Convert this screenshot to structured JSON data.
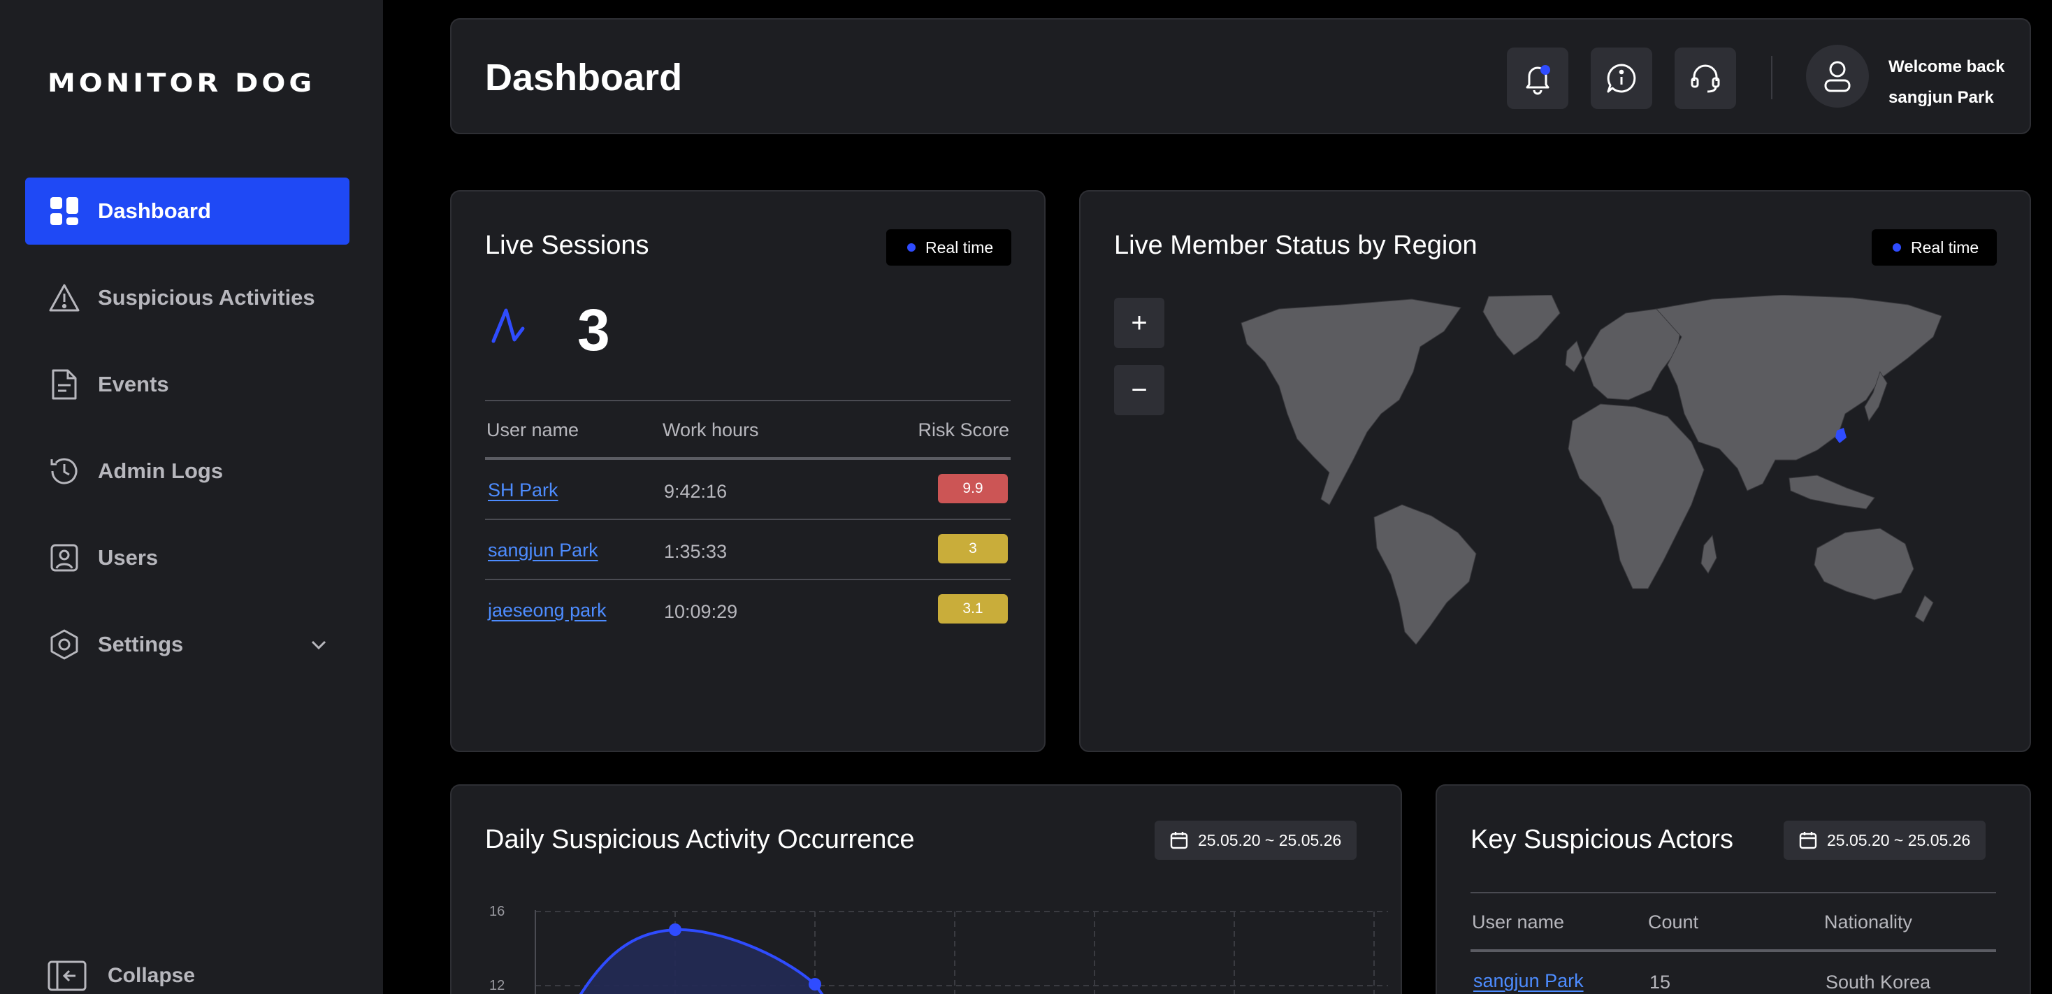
{
  "sidebar": {
    "logo": "MONITOR DOG",
    "items": [
      {
        "label": "Dashboard",
        "icon": "dashboard-icon",
        "active": true
      },
      {
        "label": "Suspicious Activities",
        "icon": "warning-icon"
      },
      {
        "label": "Events",
        "icon": "document-icon"
      },
      {
        "label": "Admin Logs",
        "icon": "history-icon"
      },
      {
        "label": "Users",
        "icon": "user-card-icon"
      },
      {
        "label": "Settings",
        "icon": "hexagon-settings-icon"
      }
    ],
    "collapse_label": "Collapse"
  },
  "header": {
    "title": "Dashboard",
    "welcome": "Welcome back",
    "user_name": "sangjun Park"
  },
  "live_sessions": {
    "title": "Live Sessions",
    "badge": "Real time",
    "count": "3",
    "columns": [
      "User name",
      "Work hours",
      "Risk Score"
    ],
    "rows": [
      {
        "user": "SH Park",
        "hours": "9:42:16",
        "score": "9.9",
        "color": "#cc5555"
      },
      {
        "user": "sangjun Park",
        "hours": "1:35:33",
        "score": "3",
        "color": "#c9ad3a"
      },
      {
        "user": "jaeseong park",
        "hours": "10:09:29",
        "score": "3.1",
        "color": "#c9ad3a"
      }
    ]
  },
  "map": {
    "title": "Live Member Status by Region",
    "badge": "Real time",
    "zoom_in": "+",
    "zoom_out": "−"
  },
  "daily": {
    "title": "Daily Suspicious Activity Occurrence",
    "date_range": "25.05.20 ~ 25.05.26"
  },
  "chart_data": {
    "type": "line",
    "y_ticks_visible": [
      "16",
      "12"
    ],
    "note_visible_points": [
      15,
      13
    ],
    "series": [
      {
        "values": [
          15,
          13
        ]
      }
    ]
  },
  "actors": {
    "title": "Key Suspicious Actors",
    "date_range": "25.05.20 ~ 25.05.26",
    "columns": [
      "User name",
      "Count",
      "Nationality"
    ],
    "rows": [
      {
        "user": "sangjun Park",
        "count": "15",
        "nationality": "South Korea"
      }
    ]
  },
  "colors": {
    "accent": "#1f49f5",
    "panel": "#1d1e22",
    "link": "#4d8cff"
  }
}
